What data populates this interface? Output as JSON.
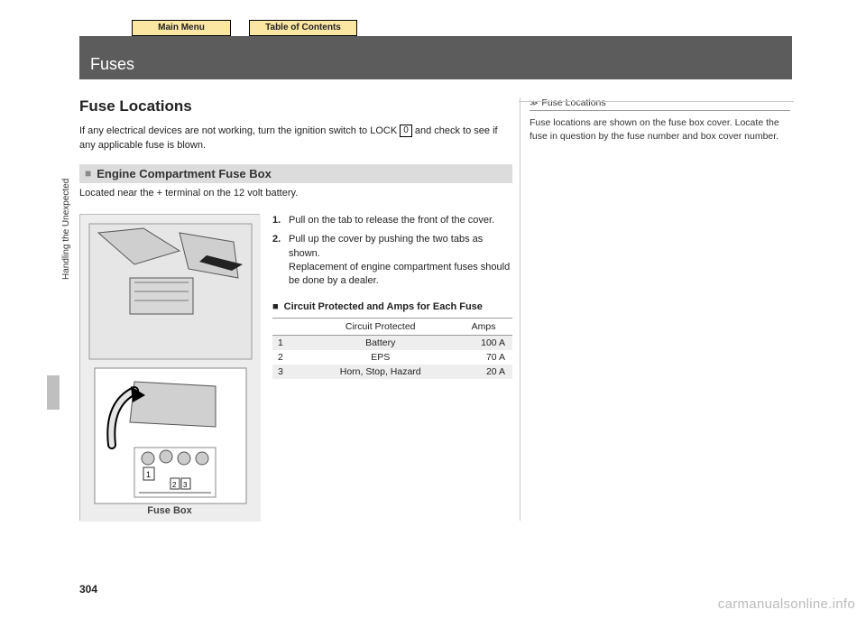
{
  "nav": {
    "main_menu": "Main Menu",
    "toc": "Table of Contents"
  },
  "header": {
    "title": "Fuses"
  },
  "spine": {
    "chapter": "Handling the Unexpected"
  },
  "page_number": "304",
  "watermark": "carmanualsonline.info",
  "section": {
    "title": "Fuse Locations",
    "intro_a": "If any electrical devices are not working, turn the ignition switch to LOCK ",
    "lock_symbol": "0",
    "intro_b": " and check to see if any applicable fuse is blown.",
    "sub_title": "Engine Compartment Fuse Box",
    "sub_body": "Located near the + terminal on the 12 volt battery.",
    "illustration_caption": "Fuse Box",
    "steps": [
      {
        "n": "1.",
        "t": "Pull on the tab to release the front of the cover."
      },
      {
        "n": "2.",
        "t": "Pull up the cover by pushing the two tabs as shown."
      }
    ],
    "step_note": "Replacement of engine compartment fuses should be done by a dealer.",
    "table_title": "Circuit Protected and Amps for Each Fuse",
    "table_headers": {
      "c1": "",
      "c2": "Circuit Protected",
      "c3": "Amps"
    },
    "table_rows": [
      {
        "n": "1",
        "name": "Battery",
        "amps": "100 A"
      },
      {
        "n": "2",
        "name": "EPS",
        "amps": "70 A"
      },
      {
        "n": "3",
        "name": "Horn, Stop, Hazard",
        "amps": "20 A"
      }
    ]
  },
  "sidebar": {
    "icon": "≫",
    "title": "Fuse Locations",
    "body": "Fuse locations are shown on the fuse box cover. Locate the fuse in question by the fuse number and box cover number."
  }
}
